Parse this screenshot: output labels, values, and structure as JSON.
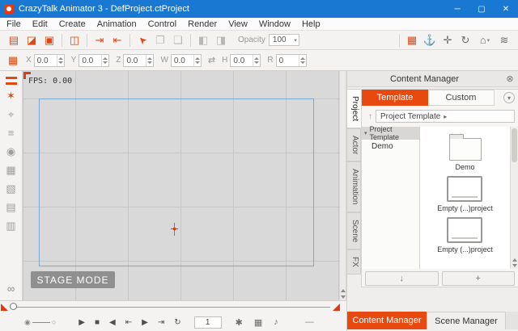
{
  "window": {
    "title": "CrazyTalk Animator 3  - DefProject.ctProject"
  },
  "menu": {
    "items": [
      "File",
      "Edit",
      "Create",
      "Animation",
      "Control",
      "Render",
      "View",
      "Window",
      "Help"
    ]
  },
  "toolbar": {
    "opacity_label": "Opacity",
    "opacity_value": "100"
  },
  "transform": {
    "fields": [
      {
        "label": "X",
        "value": "0.0"
      },
      {
        "label": "Y",
        "value": "0.0"
      },
      {
        "label": "Z",
        "value": "0.0"
      },
      {
        "label": "W",
        "value": "0.0"
      },
      {
        "label": "H",
        "value": "0.0"
      },
      {
        "label": "R",
        "value": "0"
      }
    ]
  },
  "stage": {
    "fps": "FPS: 0.00",
    "mode_label": "STAGE MODE"
  },
  "playback": {
    "frame": "1"
  },
  "content_manager": {
    "title": "Content Manager",
    "tab_template": "Template",
    "tab_custom": "Custom",
    "breadcrumb": "Project Template",
    "side_tabs": [
      "Project",
      "Actor",
      "Animation",
      "Scene",
      "FX"
    ],
    "tree_root": "Project Template",
    "tree_item": "Demo",
    "items": [
      {
        "label": "Demo"
      },
      {
        "label": "Empty (...)project"
      },
      {
        "label": "Empty (...)project"
      }
    ],
    "plus_button": "+",
    "down_button": "↓"
  },
  "bottom_tabs": {
    "content_manager": "Content Manager",
    "scene_manager": "Scene Manager"
  },
  "colors": {
    "accent": "#e8490f",
    "titlebar": "#1878d2"
  },
  "icons": {
    "minimize": "─",
    "maximize": "▢",
    "close": "✕",
    "new_file": "▤",
    "open_file": "◪",
    "save_file": "▣",
    "store_cart": "◫",
    "export_project": "⇥",
    "import_project": "⇤",
    "select_cursor": "➤",
    "copy": "❐",
    "paste": "❑",
    "flip_h": "◧",
    "flip_v": "◨",
    "image": "▦",
    "anchor": "⚓",
    "move": "✛",
    "rotate": "↻",
    "home": "⌂",
    "chevron_down": "▾",
    "waves": "≋",
    "grid_tool": "▦",
    "link_wh": "⇄",
    "actor_tool": "✶",
    "bone_tool": "⌖",
    "layers_tool": "≡",
    "info_tool": "◉",
    "sprite_tool": "▦",
    "prop_tool": "▧",
    "scene_tool": "▤",
    "library_tool": "▥",
    "loop_tool": "∞",
    "zoom_dot": "◉",
    "zoom_circle": "○",
    "play": "▶",
    "stop": "■",
    "prev_frame": "◀",
    "first_frame": "⇤",
    "next_frame": "▶",
    "last_frame": "⇥",
    "loop": "↻",
    "gear": "✱",
    "dope_sheet": "▦",
    "note": "♪",
    "dash": "—",
    "close_circle": "⊗",
    "breadcrumb_arrow": "▸",
    "tree_arrow": "▾",
    "up_level": "↑"
  }
}
